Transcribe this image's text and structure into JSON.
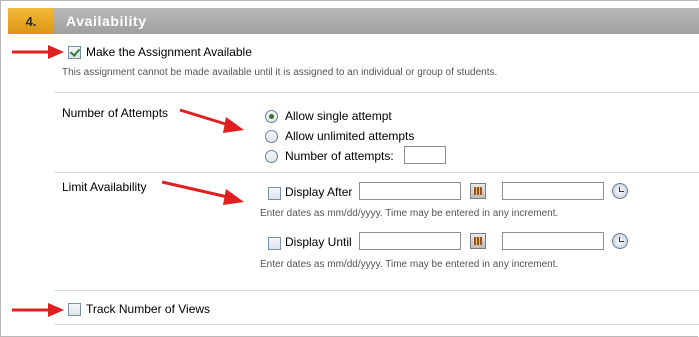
{
  "section": {
    "number": "4.",
    "title": "Availability"
  },
  "make_available": {
    "label": "Make the Assignment Available",
    "checked": true,
    "note": "This assignment cannot be made available until it is assigned to an individual or group of students."
  },
  "attempts": {
    "label": "Number of Attempts",
    "options": [
      {
        "label": "Allow single attempt",
        "selected": true
      },
      {
        "label": "Allow unlimited attempts",
        "selected": false
      },
      {
        "label": "Number of attempts:",
        "selected": false
      }
    ],
    "count_value": ""
  },
  "limit_availability": {
    "label": "Limit Availability",
    "display_after": {
      "label": "Display After",
      "checked": false,
      "date": "",
      "time": ""
    },
    "display_until": {
      "label": "Display Until",
      "checked": false,
      "date": "",
      "time": ""
    },
    "hint": "Enter dates as mm/dd/yyyy. Time may be entered in any increment."
  },
  "track_views": {
    "label": "Track Number of Views",
    "checked": false
  },
  "icons": [
    "check-icon",
    "calendar-icon",
    "clock-icon",
    "arrow-right-icon"
  ],
  "colors": {
    "step_badge": "#e8a72a",
    "header_bar": "#adadad",
    "arrow": "#e02020"
  }
}
